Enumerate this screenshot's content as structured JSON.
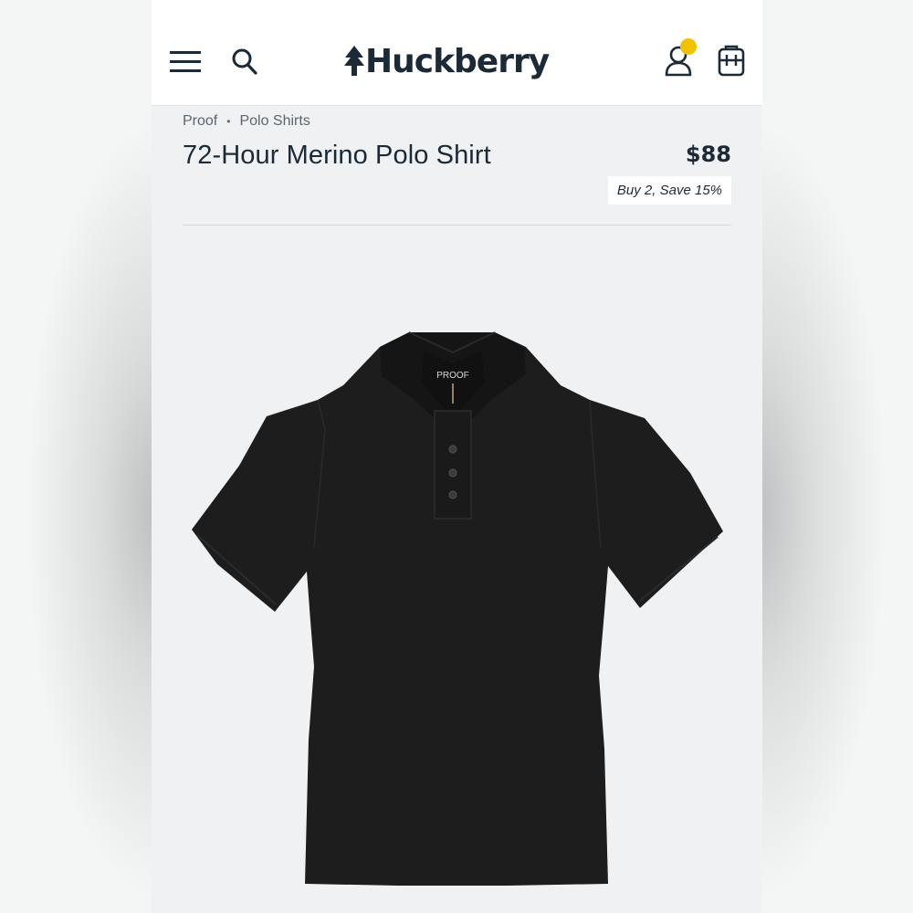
{
  "header": {
    "brand": "Huckberry",
    "menu_icon": "hamburger-menu-icon",
    "search_icon": "search-icon",
    "account_icon": "user-icon",
    "cart_icon": "backpack-icon",
    "notification_color": "#f2c200"
  },
  "breadcrumb": {
    "items": [
      "Proof",
      "Polo Shirts"
    ],
    "separator": "•"
  },
  "product": {
    "title": "72-Hour Merino Polo Shirt",
    "price": "$88",
    "promo": "Buy 2, Save 15%",
    "image_label_brand": "PROOF",
    "shirt_color": "#1a1a1a"
  },
  "colors": {
    "text_primary": "#1b2a36",
    "background": "#eff1f2",
    "header_bg": "#ffffff"
  }
}
